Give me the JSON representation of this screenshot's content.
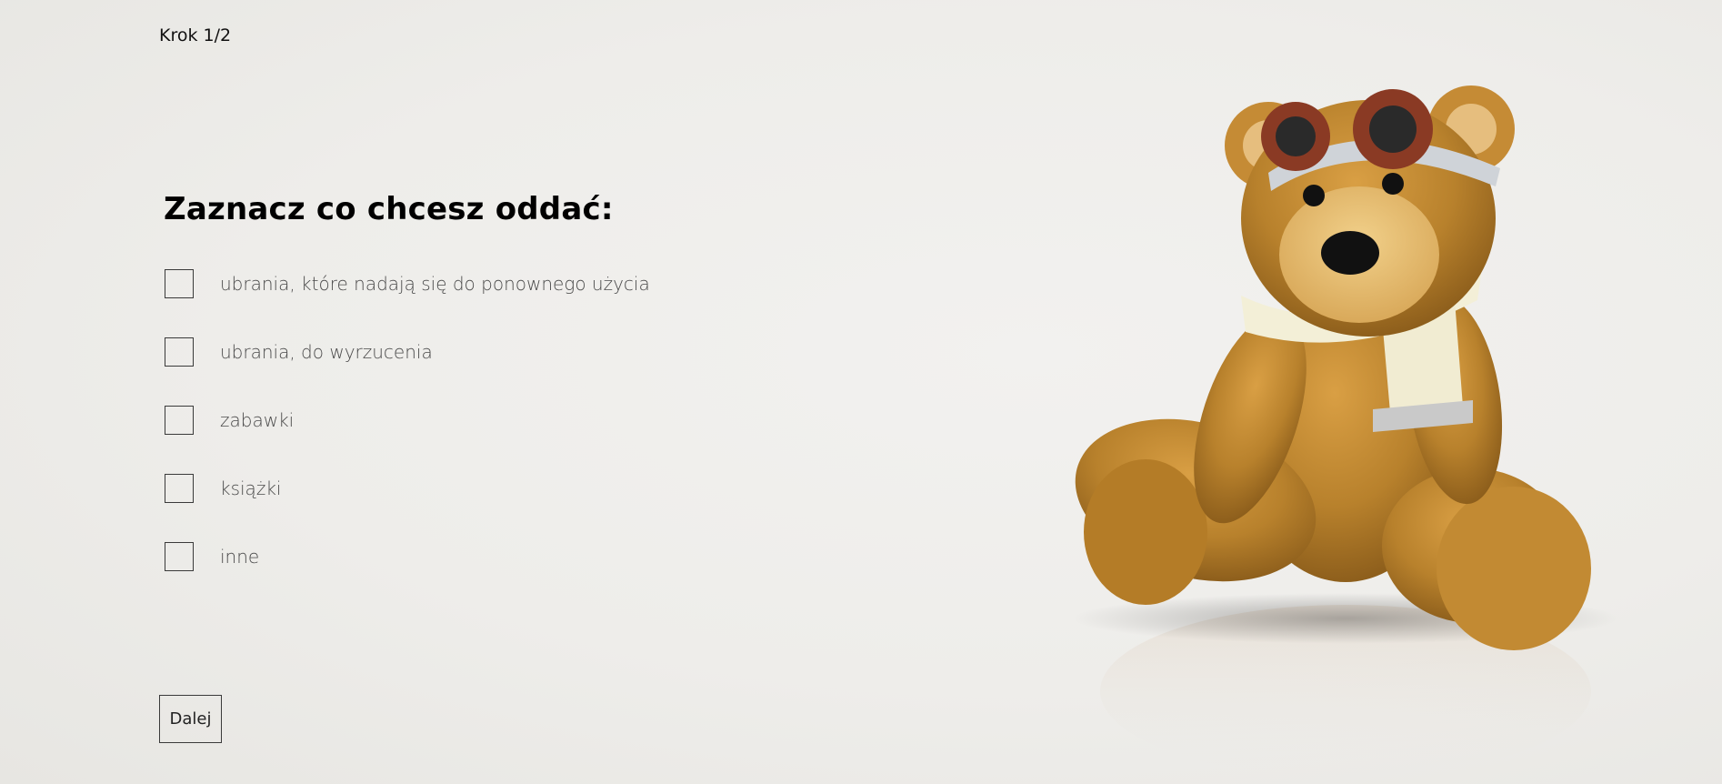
{
  "step": {
    "label": "Krok 1/2"
  },
  "form": {
    "title": "Zaznacz co chcesz oddać:",
    "options": [
      {
        "label": "ubrania, które nadają się do ponownego użycia",
        "checked": false
      },
      {
        "label": "ubrania, do wyrzucenia",
        "checked": false
      },
      {
        "label": "zabawki",
        "checked": false
      },
      {
        "label": "książki",
        "checked": false
      },
      {
        "label": "inne",
        "checked": false
      }
    ],
    "next_label": "Dalej"
  },
  "illustration": {
    "subject": "teddy-bear-with-goggles-and-scarf",
    "colors": {
      "fur": "#b8812c",
      "fur_light": "#e0b46a",
      "goggles": "#8a3a24",
      "scarf": "#f3efd7",
      "background": "#eeedea"
    }
  }
}
